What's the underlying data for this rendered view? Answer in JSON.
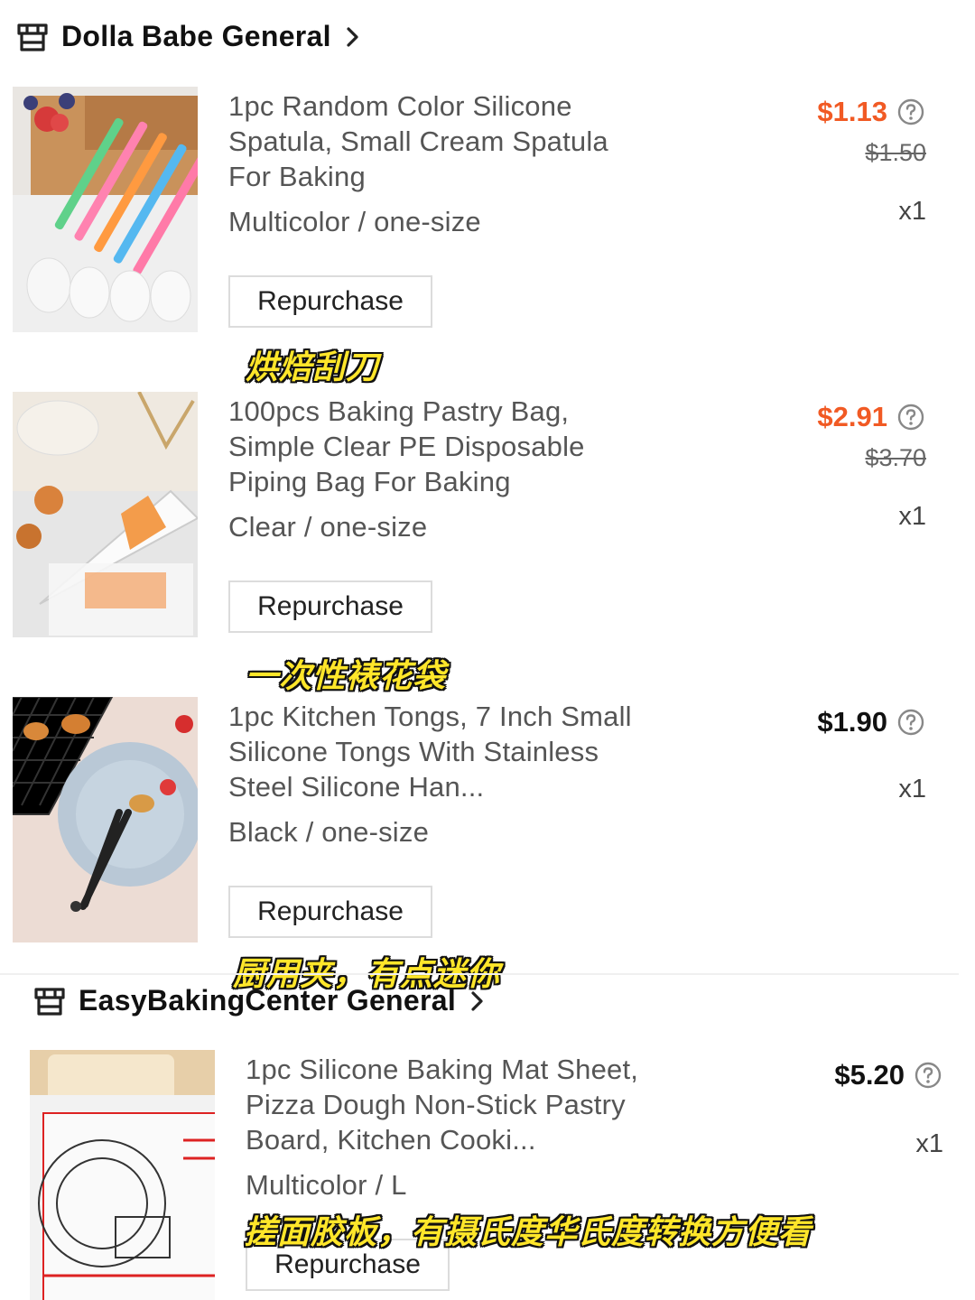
{
  "stores": [
    {
      "name": "Dolla Babe General",
      "items": [
        {
          "title": "1pc Random Color Silicone Spatula, Small Cream Spatula For Baking",
          "variant": "Multicolor / one-size",
          "price": "$1.13",
          "original_price": "$1.50",
          "qty": "x1",
          "button": "Repurchase",
          "caption": "烘焙刮刀"
        },
        {
          "title": "100pcs Baking Pastry Bag, Simple Clear PE Disposable Piping Bag For Baking",
          "variant": "Clear / one-size",
          "price": "$2.91",
          "original_price": "$3.70",
          "qty": "x1",
          "button": "Repurchase",
          "caption": "一次性裱花袋"
        },
        {
          "title": "1pc Kitchen Tongs, 7 Inch Small Silicone Tongs With Stainless Steel Silicone Han...",
          "variant": "Black / one-size",
          "price": "$1.90",
          "qty": "x1",
          "button": "Repurchase",
          "caption": "厨用夹，有点迷你"
        }
      ]
    },
    {
      "name": "EasyBakingCenter General",
      "items": [
        {
          "title": "1pc Silicone Baking Mat Sheet, Pizza Dough Non-Stick Pastry Board, Kitchen Cooki...",
          "variant": "Multicolor / L",
          "price": "$5.20",
          "qty": "x1",
          "button": "Repurchase",
          "caption": "搓面胶板，有摄氏度华氏度转换方便看"
        }
      ]
    }
  ],
  "colors": {
    "sale": "#f15a24",
    "caption": "#ffe62a"
  },
  "icons": {
    "store": "store-icon",
    "chevron": "chevron-right-icon",
    "help": "question-circle-icon"
  }
}
